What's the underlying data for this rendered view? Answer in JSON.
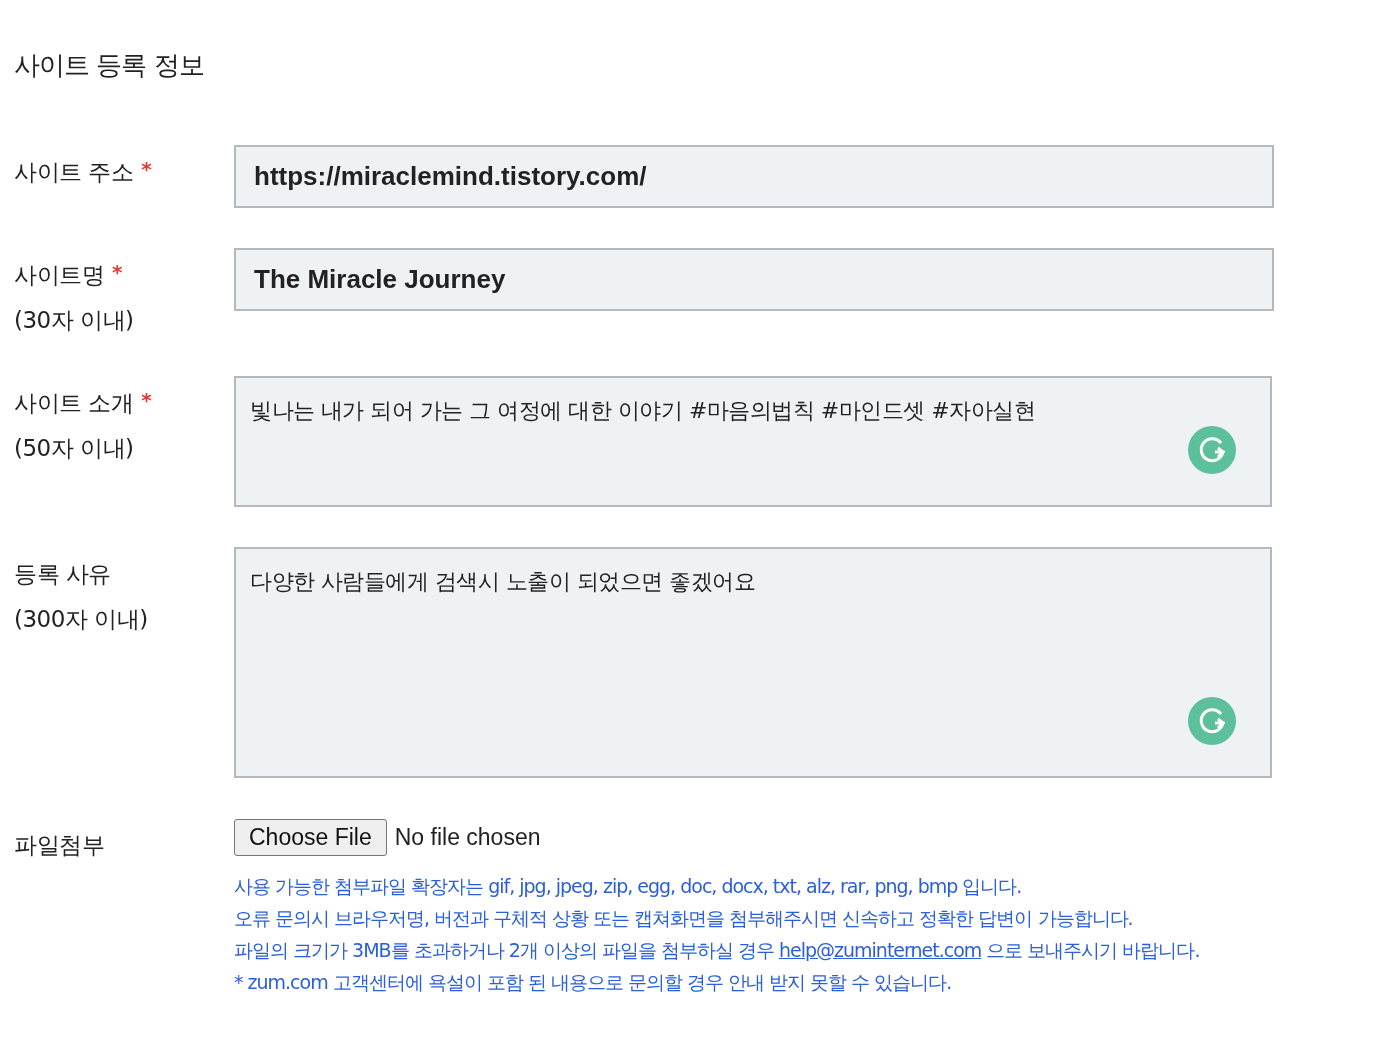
{
  "title": "사이트 등록 정보",
  "fields": [
    {
      "kind": "input",
      "label": "사이트 주소",
      "required": true,
      "value": "https://miraclemind.tistory.com/"
    },
    {
      "kind": "input",
      "label": "사이트명",
      "required": true,
      "limit": "(30자 이내)",
      "value": "The Miracle Journey"
    },
    {
      "kind": "textarea",
      "label": "사이트 소개",
      "required": true,
      "limit": "(50자 이내)",
      "value": "빛나는 내가 되어 가는 그 여정에 대한 이야기 #마음의법칙 #마인드셋 #자아실현",
      "grammarly": true
    },
    {
      "kind": "long_textarea",
      "label": "등록 사유",
      "required": false,
      "limit": "(300자 이내)",
      "value": "다양한 사람들에게 검색시 노출이 되었으면 좋겠어요",
      "grammarly": true
    },
    {
      "kind": "file",
      "label": "파일첨부",
      "required": false,
      "button": "Choose File",
      "status": "No file chosen"
    }
  ],
  "required_mark": "*",
  "notes": [
    {
      "text": "사용 가능한 첨부파일 확장자는 gif, jpg, jpeg, zip, egg, doc, docx, txt, alz, rar, png, bmp 입니다."
    },
    {
      "text": "오류 문의시 브라우저명, 버전과 구체적 상황 또는 캡쳐화면을 첨부해주시면 신속하고 정확한 답변이 가능합니다."
    },
    {
      "text": "파일의 크기가 3MB를 초과하거나 2개 이상의 파일을 첨부하실 경우",
      "link": "help@zuminternet.com",
      "after": "으로 보내주시기 바랍니다."
    },
    {
      "text": " * zum.com 고객센터에 욕설이 포함 된 내용으로 문의할 경우 안내 받지 못할 수 있습니다."
    }
  ]
}
